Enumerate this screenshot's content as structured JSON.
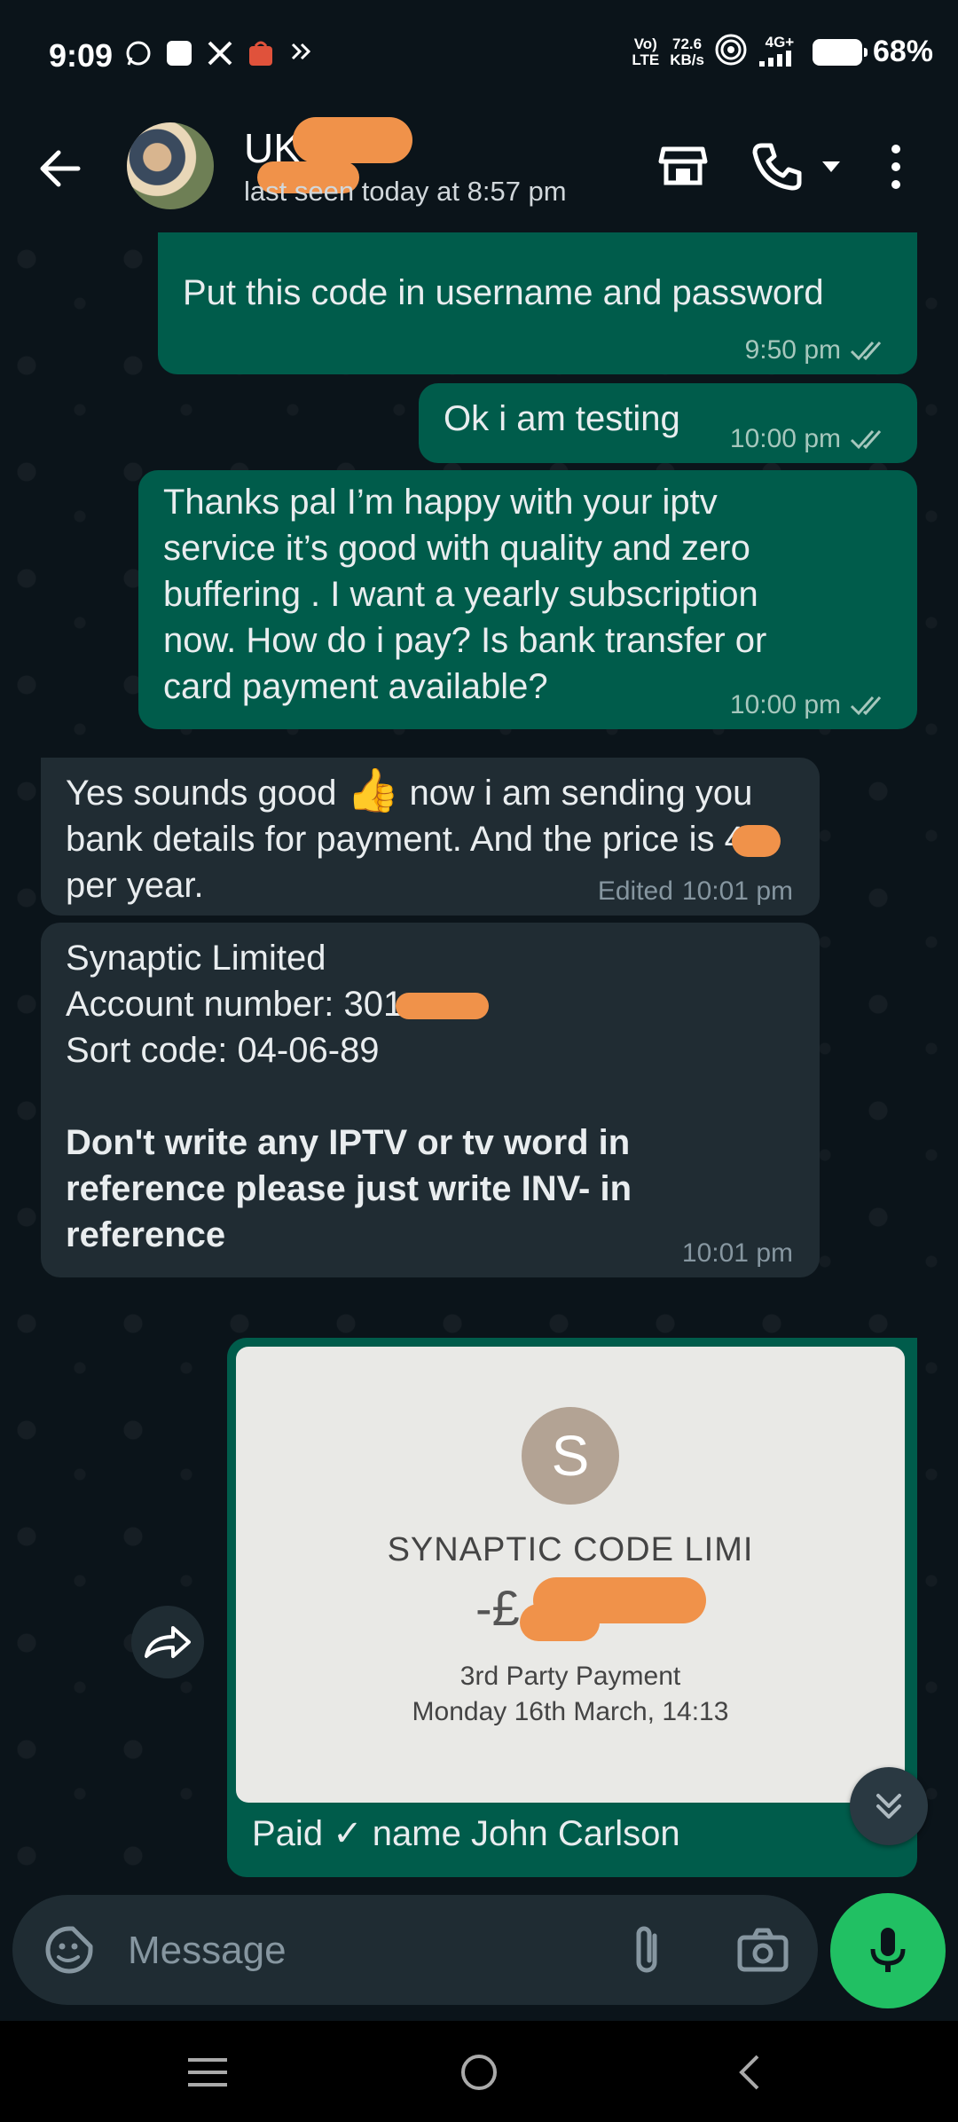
{
  "status_bar": {
    "time": "9:09",
    "network_top": "Vo)",
    "network_bottom": "LTE",
    "speed_top": "72.6",
    "speed_bottom": "KB/s",
    "signal_label": "4G+",
    "battery": "68%"
  },
  "header": {
    "contact_name": "UK",
    "last_seen": "last seen today at 8:57 pm"
  },
  "messages": [
    {
      "text": "Put this code in username and password",
      "time": "9:50 pm"
    },
    {
      "text": "Ok i am testing",
      "time": "10:00 pm"
    },
    {
      "text": "Thanks pal I’m happy with your iptv service it’s good with quality and zero buffering . I want a yearly subscription now. How do i pay? Is bank transfer or card payment available?",
      "time": "10:00 pm"
    },
    {
      "text_a": "Yes sounds good",
      "emoji": "👍",
      "text_b": "now i am sending you bank details for payment. And the price is 4",
      "text_c": "per year.",
      "edited": "Edited",
      "time": "10:01 pm"
    },
    {
      "line1": "Synaptic  Limited",
      "line2": "Account number: 301",
      "line3": "Sort code: 04-06-89",
      "bold": "Don't write any IPTV or tv word in reference please just write INV- in reference",
      "time": "10:01 pm"
    },
    {
      "image": {
        "initial": "S",
        "merchant": "SYNAPTIC CODE LIMI",
        "amount": "-£",
        "type": "3rd Party Payment",
        "date": "Monday 16th March, 14:13"
      },
      "caption": "Paid ✓ name John Carlson"
    }
  ],
  "composer": {
    "placeholder": "Message"
  }
}
